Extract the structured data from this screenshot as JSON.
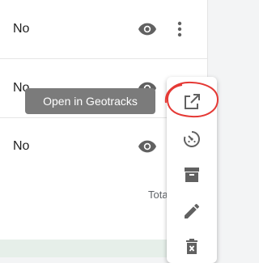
{
  "rows": [
    {
      "value": "No"
    },
    {
      "value": "No"
    },
    {
      "value": "No"
    }
  ],
  "footer": {
    "total_label": "Tota"
  },
  "tooltip": {
    "text": "Open in Geotracks"
  },
  "menu": {
    "items": [
      {
        "icon": "open-in-new-icon"
      },
      {
        "icon": "speed-dial-icon"
      },
      {
        "icon": "archive-icon"
      },
      {
        "icon": "edit-pencil-icon"
      },
      {
        "icon": "delete-icon"
      }
    ]
  },
  "colors": {
    "icon": "#616161",
    "tooltip_bg": "#7b7b7b",
    "annotation": "#e53935",
    "footer_bg": "#e6efe9"
  }
}
